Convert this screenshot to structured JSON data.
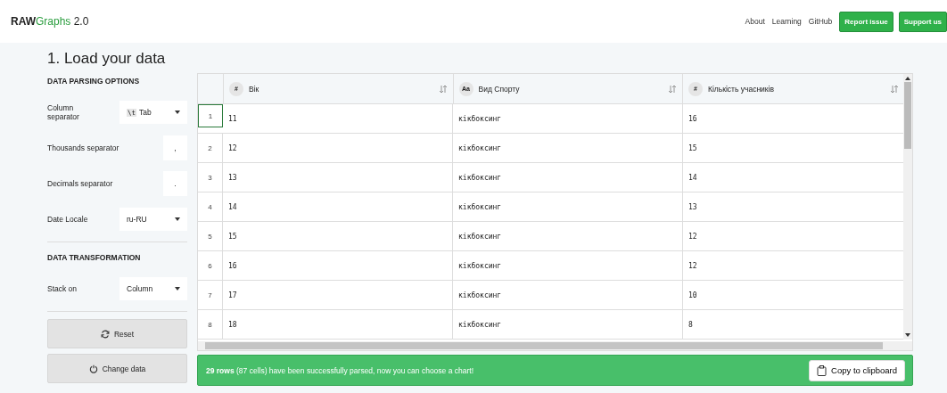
{
  "header": {
    "logo_bold": "RAW",
    "logo_green": "Graphs",
    "version": "2.0",
    "links": [
      "About",
      "Learning",
      "GitHub"
    ],
    "buttons": [
      "Report issue",
      "Support us"
    ]
  },
  "title": "1. Load your data",
  "parsing": {
    "heading": "DATA PARSING OPTIONS",
    "options": [
      {
        "label": "Column separator",
        "kind": "select",
        "code": "\\t",
        "value": "Tab"
      },
      {
        "label": "Thousands separator",
        "kind": "input",
        "value": ","
      },
      {
        "label": "Decimals separator",
        "kind": "input",
        "value": "."
      },
      {
        "label": "Date Locale",
        "kind": "select",
        "value": "ru-RU"
      }
    ]
  },
  "transformation": {
    "heading": "DATA TRANSFORMATION",
    "options": [
      {
        "label": "Stack on",
        "kind": "select",
        "value": "Column"
      }
    ]
  },
  "actions": [
    {
      "label": "Reset",
      "kind": "reset"
    },
    {
      "label": "Change data",
      "kind": "change"
    }
  ],
  "table": {
    "columns": [
      {
        "badge": "#",
        "name": "Вік"
      },
      {
        "badge": "Aa",
        "name": "Вид Спорту"
      },
      {
        "badge": "#",
        "name": "Кількість учасників"
      }
    ],
    "rows": [
      {
        "index": "1",
        "selected": true,
        "cells": [
          "11",
          "кікбоксинг",
          "16"
        ]
      },
      {
        "index": "2",
        "selected": false,
        "cells": [
          "12",
          "кікбоксинг",
          "15"
        ]
      },
      {
        "index": "3",
        "selected": false,
        "cells": [
          "13",
          "кікбоксинг",
          "14"
        ]
      },
      {
        "index": "4",
        "selected": false,
        "cells": [
          "14",
          "кікбоксинг",
          "13"
        ]
      },
      {
        "index": "5",
        "selected": false,
        "cells": [
          "15",
          "кікбоксинг",
          "12"
        ]
      },
      {
        "index": "6",
        "selected": false,
        "cells": [
          "16",
          "кікбоксинг",
          "12"
        ]
      },
      {
        "index": "7",
        "selected": false,
        "cells": [
          "17",
          "кікбоксинг",
          "10"
        ]
      },
      {
        "index": "8",
        "selected": false,
        "cells": [
          "18",
          "кікбоксинг",
          "8"
        ]
      }
    ]
  },
  "status": {
    "message": "**29 rows** (87 cells) have been successfully parsed, now you can choose a chart!",
    "button": "Copy to clipboard"
  }
}
